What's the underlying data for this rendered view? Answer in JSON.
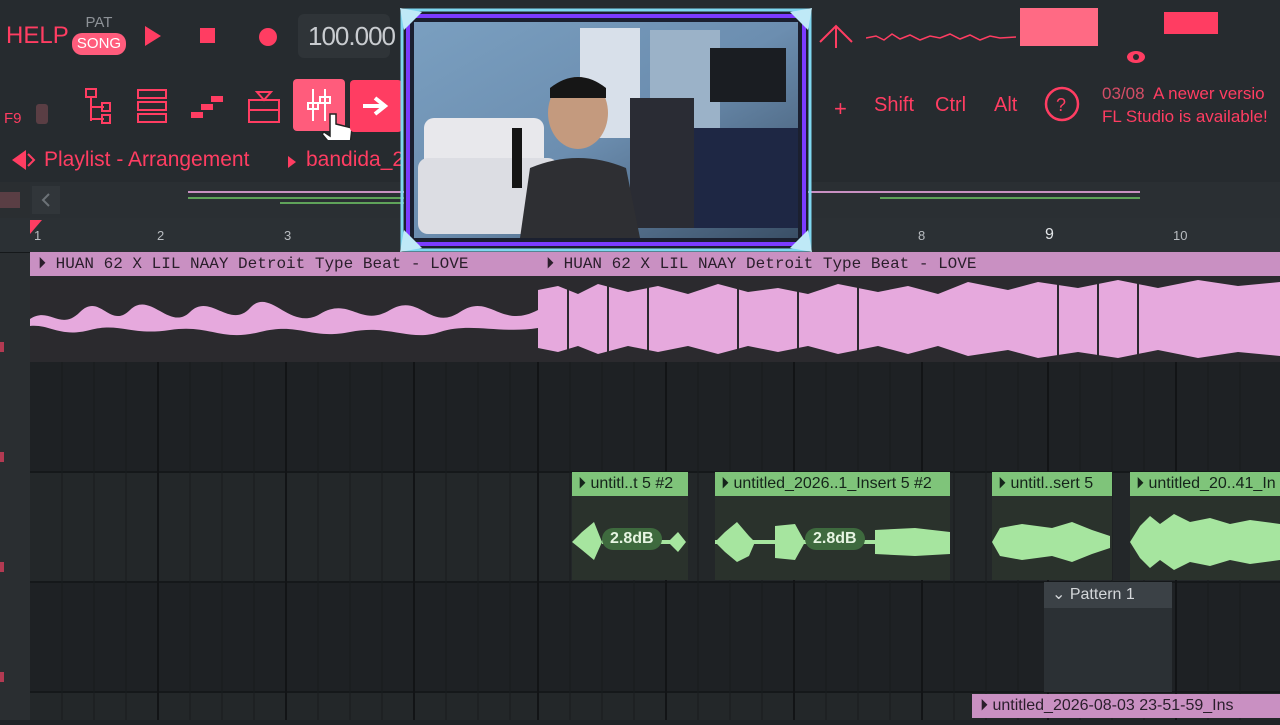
{
  "top": {
    "help": "HELP",
    "pat": "PAT",
    "song": "SONG",
    "tempo": "100.000",
    "f9": "F9",
    "shift": "Shift",
    "ctrl": "Ctrl",
    "alt": "Alt",
    "news_date": "03/08",
    "news_line1": "A newer versio",
    "news_line2": "FL Studio is available!"
  },
  "window": {
    "title": "Playlist - Arrangement",
    "crumb": "bandida_2"
  },
  "ruler": [
    "1",
    "2",
    "3",
    "8",
    "9",
    "10"
  ],
  "clips": {
    "main1": "HUAN 62 X LIL NAAY Detroit Type Beat - LOVE",
    "main2": "HUAN 62 X LIL NAAY Detroit Type Beat - LOVE",
    "v1": "untitl..t 5 #2",
    "v2": "untitled_2026..1_Insert 5 #2",
    "v3": "untitl..sert 5",
    "v4": "untitled_20..41_In",
    "db1": "2.8dB",
    "db2": "2.8dB",
    "pattern": "Pattern 1",
    "bottom": "untitled_2026-08-03 23-51-59_Ins"
  },
  "colors": {
    "accent": "#ff3d62",
    "audio_pink": "#c990c2",
    "audio_green": "#7fc47a"
  }
}
